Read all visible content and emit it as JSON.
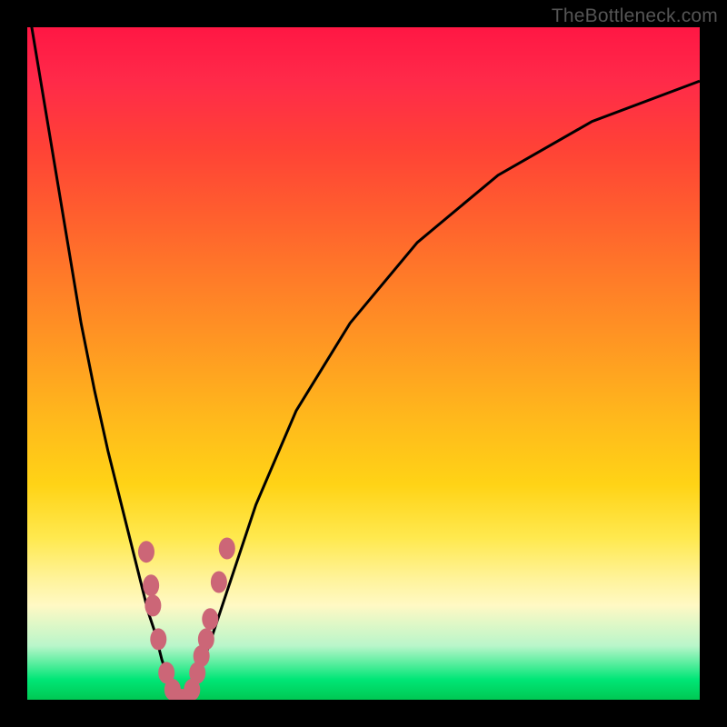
{
  "watermark": "TheBottleneck.com",
  "chart_data": {
    "type": "line",
    "title": "",
    "xlabel": "",
    "ylabel": "",
    "xlim": [
      0,
      100
    ],
    "ylim": [
      0,
      100
    ],
    "series": [
      {
        "name": "curve",
        "x": [
          0,
          2,
          4,
          6,
          8,
          10,
          12,
          14,
          16,
          18,
          19,
          20,
          21,
          22,
          23,
          24,
          25,
          27,
          30,
          34,
          40,
          48,
          58,
          70,
          84,
          100
        ],
        "y": [
          104,
          92,
          80,
          68,
          56,
          46,
          37,
          29,
          21,
          13,
          10,
          6,
          3,
          1,
          0,
          1,
          3,
          8,
          17,
          29,
          43,
          56,
          68,
          78,
          86,
          92
        ]
      }
    ],
    "markers": [
      {
        "x": 17.7,
        "y": 22.0
      },
      {
        "x": 18.4,
        "y": 17.0
      },
      {
        "x": 18.7,
        "y": 14.0
      },
      {
        "x": 19.5,
        "y": 9.0
      },
      {
        "x": 20.7,
        "y": 4.0
      },
      {
        "x": 21.6,
        "y": 1.5
      },
      {
        "x": 23.0,
        "y": 0.0
      },
      {
        "x": 24.5,
        "y": 1.5
      },
      {
        "x": 25.3,
        "y": 4.0
      },
      {
        "x": 25.9,
        "y": 6.5
      },
      {
        "x": 26.6,
        "y": 9.0
      },
      {
        "x": 27.2,
        "y": 12.0
      },
      {
        "x": 28.5,
        "y": 17.5
      },
      {
        "x": 29.7,
        "y": 22.5
      }
    ],
    "colors": {
      "curve": "#000000",
      "marker_fill": "#cc6677",
      "marker_stroke": "#cc6677"
    }
  }
}
